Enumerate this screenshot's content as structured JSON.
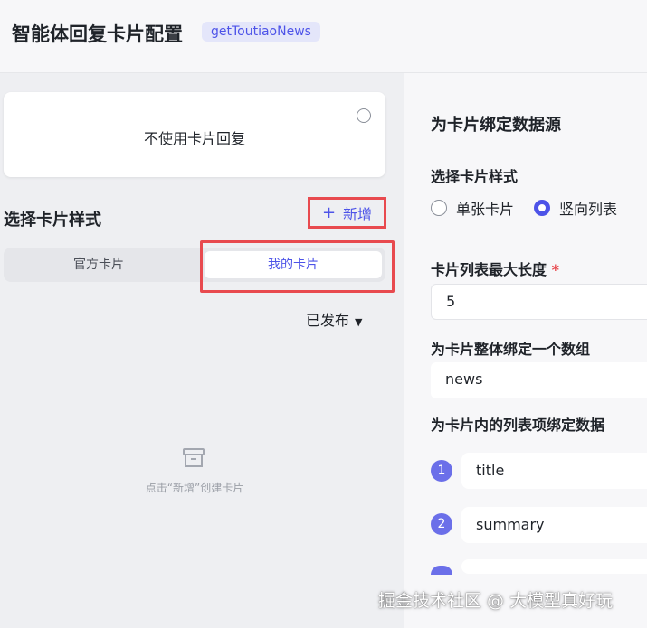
{
  "header": {
    "title": "智能体回复卡片配置",
    "badge": "getToutiaoNews"
  },
  "left": {
    "no_card_label": "不使用卡片回复",
    "section_title": "选择卡片样式",
    "add_label": "新增",
    "add_icon": "plus-icon",
    "tabs": [
      {
        "label": "官方卡片",
        "active": false
      },
      {
        "label": "我的卡片",
        "active": true
      }
    ],
    "status_filter": "已发布",
    "empty_icon": "archive-box-icon",
    "empty_text": "点击“新增”创建卡片"
  },
  "right": {
    "title": "为卡片绑定数据源",
    "style_label": "选择卡片样式",
    "style_options": [
      {
        "label": "单张卡片",
        "selected": false
      },
      {
        "label": "竖向列表",
        "selected": true
      }
    ],
    "max_len_label": "卡片列表最大长度",
    "required_mark": "*",
    "max_len_value": "5",
    "array_label": "为卡片整体绑定一个数组",
    "array_value": "news",
    "items_label": "为卡片内的列表项绑定数据",
    "items": [
      {
        "index": "1",
        "value": "title"
      },
      {
        "index": "2",
        "value": "summary"
      }
    ]
  },
  "watermark": "掘金技术社区 @ 大模型真好玩",
  "colors": {
    "accent": "#4d53e8",
    "highlight_box": "#e84a4f",
    "number_badge": "#6b6fe9"
  }
}
